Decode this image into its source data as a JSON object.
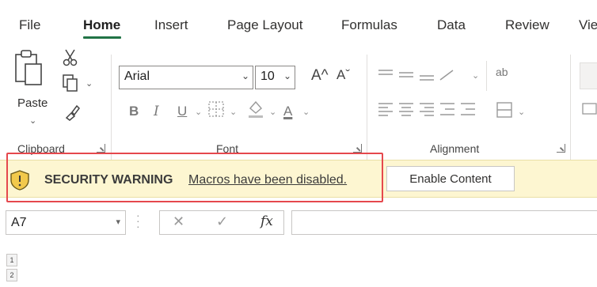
{
  "menu": {
    "tabs": [
      "File",
      "Home",
      "Insert",
      "Page Layout",
      "Formulas",
      "Data",
      "Review",
      "Vie"
    ],
    "active": "Home"
  },
  "ribbon": {
    "clipboard": {
      "paste_label": "Paste",
      "group_label": "Clipboard"
    },
    "font": {
      "font_name": "Arial",
      "font_size": "10",
      "grow_glyph": "A^",
      "shrink_glyph": "Aˇ",
      "bold": "B",
      "italic": "I",
      "underline": "U",
      "font_color_glyph": "A",
      "group_label": "Font"
    },
    "alignment": {
      "group_label": "Alignment",
      "wrap_glyph": "ab"
    }
  },
  "security_bar": {
    "title": "SECURITY WARNING",
    "message": "Macros have been disabled.",
    "button_label": "Enable Content",
    "colors": {
      "background": "#fdf6d1",
      "highlight": "#e5484d",
      "shield": "#f2c94c"
    }
  },
  "formula_bar": {
    "name_box": "A7",
    "cancel_glyph": "✕",
    "enter_glyph": "✓",
    "fx_label": "fx",
    "formula": ""
  },
  "grid": {
    "row_numbers": [
      "1",
      "2"
    ]
  },
  "colors": {
    "accent": "#217346"
  }
}
